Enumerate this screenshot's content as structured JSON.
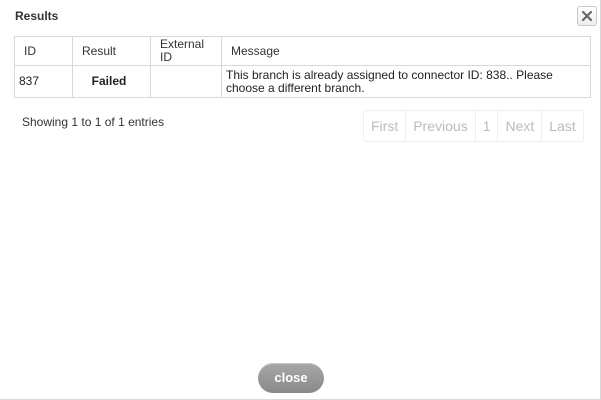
{
  "dialog": {
    "title": "Results",
    "close_icon": "close-icon"
  },
  "table": {
    "headers": [
      "ID",
      "Result",
      "External ID",
      "Message"
    ],
    "rows": [
      {
        "id": "837",
        "result": "Failed",
        "external_id": "",
        "message": "This branch is already assigned to connector ID: 838.. Please choose a different branch."
      }
    ]
  },
  "info": {
    "text": "Showing 1 to 1 of 1 entries"
  },
  "pagination": {
    "first": "First",
    "previous": "Previous",
    "page": "1",
    "next": "Next",
    "last": "Last"
  },
  "footer": {
    "close_label": "close"
  },
  "colors": {
    "failed": "#d01818",
    "button": "#999999"
  }
}
